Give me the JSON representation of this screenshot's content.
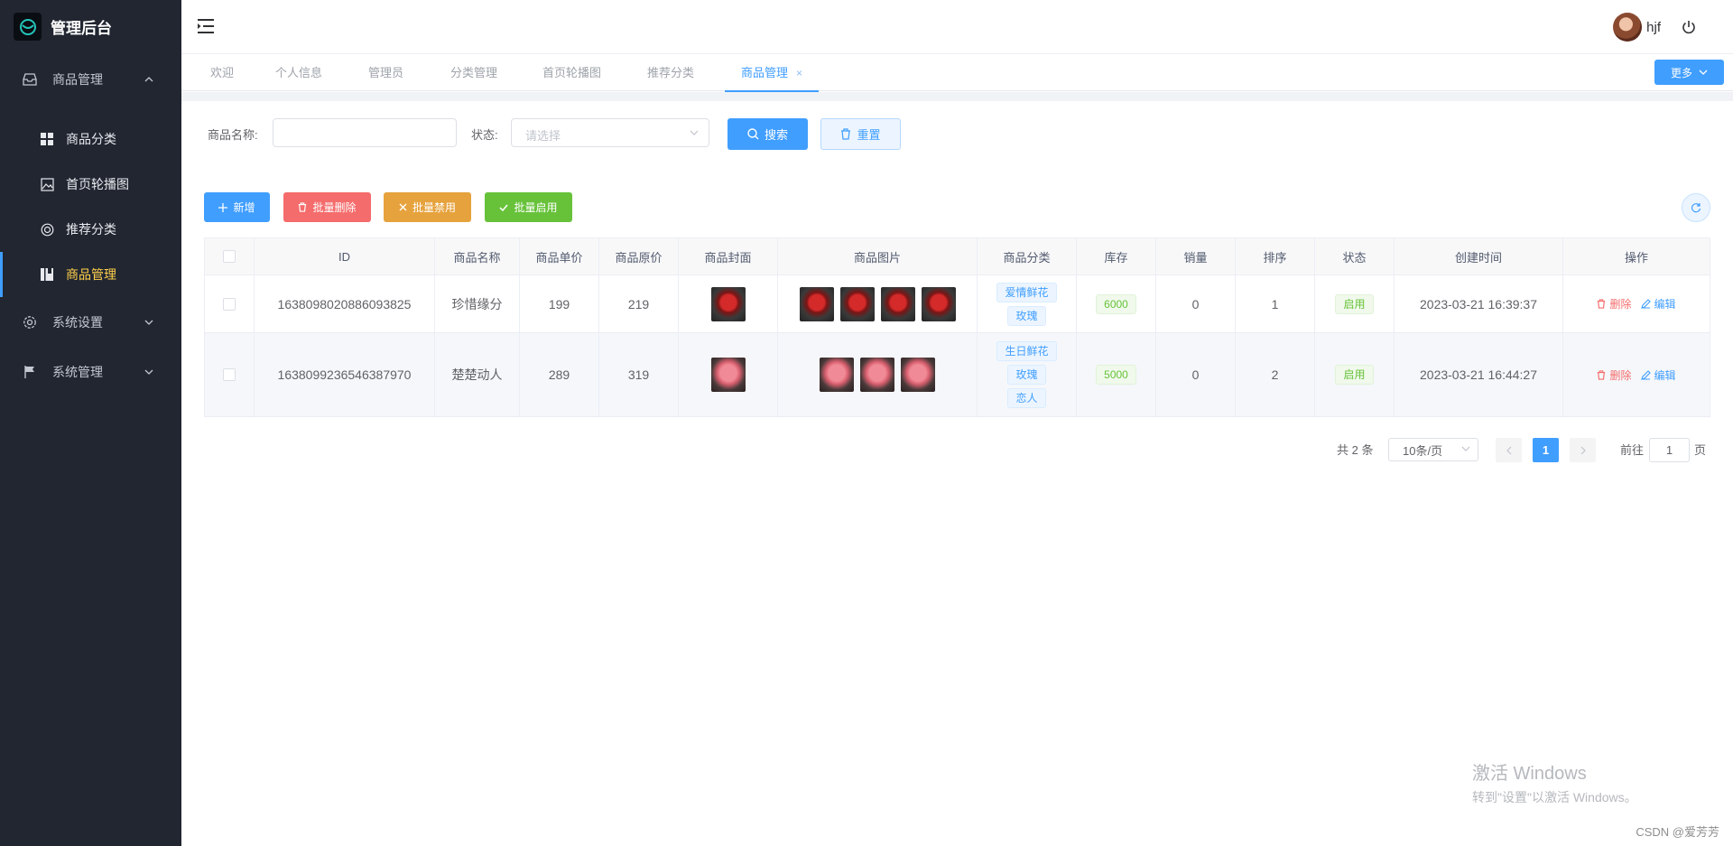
{
  "app": {
    "title": "管理后台"
  },
  "sidebar": {
    "groups": [
      {
        "label": "商品管理",
        "icon": "inbox-icon"
      },
      {
        "label": "系统设置",
        "icon": "gear-icon"
      },
      {
        "label": "系统管理",
        "icon": "flag-icon"
      }
    ],
    "items": [
      {
        "label": "商品分类",
        "icon": "grid-icon"
      },
      {
        "label": "首页轮播图",
        "icon": "image-icon"
      },
      {
        "label": "推荐分类",
        "icon": "life-ring-icon"
      },
      {
        "label": "商品管理",
        "icon": "notebook-icon"
      }
    ]
  },
  "header": {
    "username": "hjf"
  },
  "tabs": [
    {
      "label": "欢迎"
    },
    {
      "label": "个人信息"
    },
    {
      "label": "管理员"
    },
    {
      "label": "分类管理"
    },
    {
      "label": "首页轮播图"
    },
    {
      "label": "推荐分类"
    },
    {
      "label": "商品管理",
      "close": "×"
    }
  ],
  "more_label": "更多",
  "search": {
    "name_label": "商品名称:",
    "name_value": "",
    "status_label": "状态:",
    "status_placeholder": "请选择",
    "search_btn": "搜索",
    "reset_btn": "重置"
  },
  "toolbar": {
    "add": "新增",
    "batch_delete": "批量删除",
    "batch_disable": "批量禁用",
    "batch_enable": "批量启用"
  },
  "table": {
    "columns": [
      "ID",
      "商品名称",
      "商品单价",
      "商品原价",
      "商品封面",
      "商品图片",
      "商品分类",
      "库存",
      "销量",
      "排序",
      "状态",
      "创建时间",
      "操作"
    ],
    "rows": [
      {
        "id": "1638098020886093825",
        "name": "珍惜缘分",
        "price": "199",
        "orig_price": "219",
        "categories": [
          "爱情鲜花",
          "玫瑰"
        ],
        "stock": "6000",
        "sales": "0",
        "sort": "1",
        "status": "启用",
        "created": "2023-03-21 16:39:37",
        "delete": "删除",
        "edit": "编辑"
      },
      {
        "id": "1638099236546387970",
        "name": "楚楚动人",
        "price": "289",
        "orig_price": "319",
        "categories": [
          "生日鲜花",
          "玫瑰",
          "恋人"
        ],
        "stock": "5000",
        "sales": "0",
        "sort": "2",
        "status": "启用",
        "created": "2023-03-21 16:44:27",
        "delete": "删除",
        "edit": "编辑"
      }
    ]
  },
  "pagination": {
    "total": "共 2 条",
    "page_size": "10条/页",
    "current": "1",
    "goto_prefix": "前往",
    "goto_value": "1",
    "goto_suffix": "页"
  },
  "watermark": {
    "line1": "激活 Windows",
    "line2": "转到\"设置\"以激活 Windows。"
  },
  "credit": "CSDN @爱芳芳",
  "colors": {
    "primary": "#409eff",
    "danger": "#f56c6c",
    "warning": "#e6a23c",
    "success": "#67c23a",
    "sidebar": "#212631",
    "active_menu": "#ffd04b"
  }
}
